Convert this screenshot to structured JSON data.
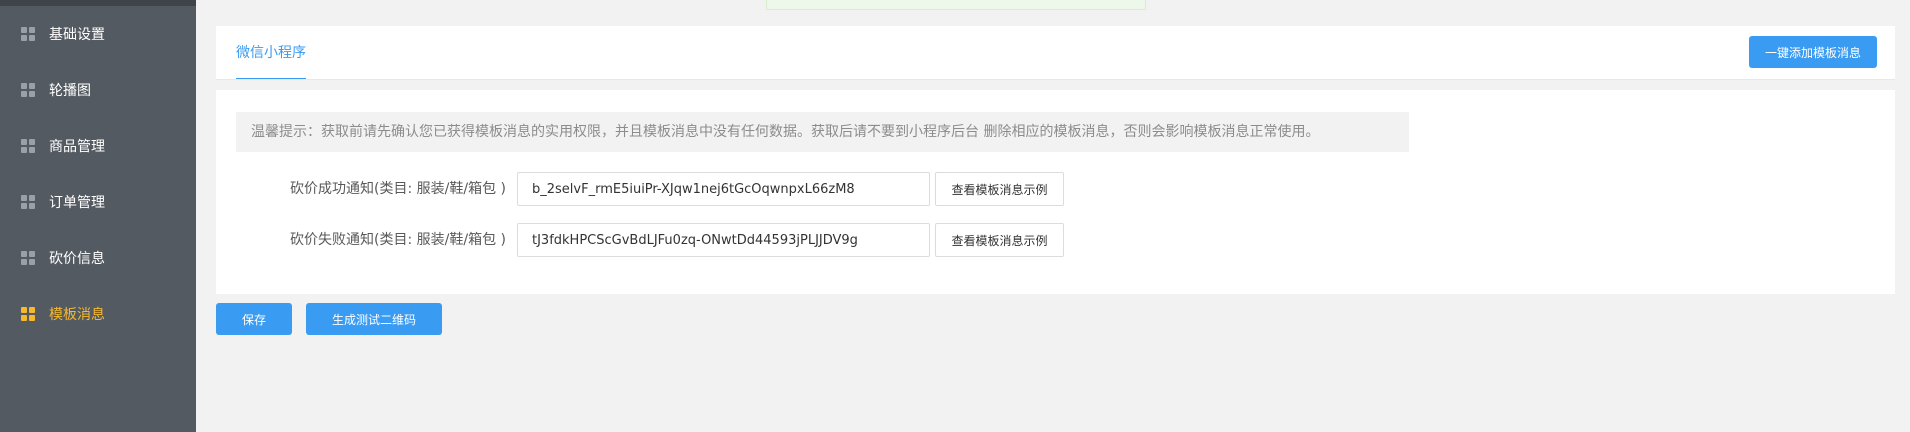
{
  "sidebar": {
    "items": [
      {
        "label": "基础设置",
        "icon": "grid-icon"
      },
      {
        "label": "轮播图",
        "icon": "grid-icon"
      },
      {
        "label": "商品管理",
        "icon": "grid-icon"
      },
      {
        "label": "订单管理",
        "icon": "grid-icon"
      },
      {
        "label": "砍价信息",
        "icon": "grid-icon"
      },
      {
        "label": "模板消息",
        "icon": "grid-icon",
        "active": true
      }
    ],
    "active_color": "#f5b82e",
    "background": "#545a61"
  },
  "header": {
    "tab_label": "微信小程序",
    "add_button_label": "一键添加模板消息"
  },
  "content": {
    "tip": "温馨提示：获取前请先确认您已获得模板消息的实用权限，并且模板消息中没有任何数据。获取后请不要到小程序后台 删除相应的模板消息，否则会影响模板消息正常使用。",
    "rows": [
      {
        "label": "砍价成功通知(类目: 服装/鞋/箱包 )",
        "value": "b_2selvF_rmE5iuiPr-XJqw1nej6tGcOqwnpxL66zM8",
        "button": "查看模板消息示例"
      },
      {
        "label": "砍价失败通知(类目: 服装/鞋/箱包 )",
        "value": "tJ3fdkHPCScGvBdLJFu0zq-ONwtDd44593jPLJJDV9g",
        "button": "查看模板消息示例"
      }
    ]
  },
  "footer": {
    "save_label": "保存",
    "qr_label": "生成测试二维码"
  },
  "colors": {
    "primary": "#3a9bf2"
  }
}
